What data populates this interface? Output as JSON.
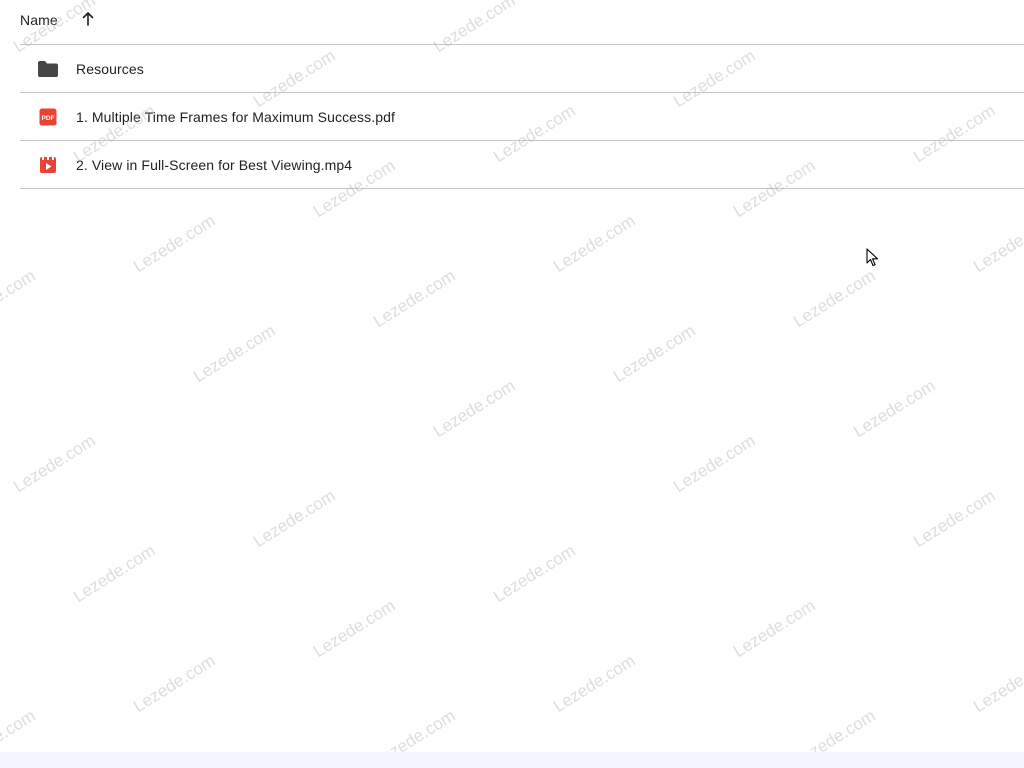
{
  "header": {
    "name_label": "Name",
    "sort_direction": "ascending"
  },
  "files": [
    {
      "name": "Resources",
      "type": "folder",
      "icon": "folder-icon",
      "icon_color": "#444746"
    },
    {
      "name": "1. Multiple Time Frames for Maximum Success.pdf",
      "type": "pdf",
      "icon": "pdf-icon",
      "icon_color": "#ea4335",
      "icon_text": "PDF"
    },
    {
      "name": "2. View in Full-Screen for Best Viewing.mp4",
      "type": "video",
      "icon": "video-icon",
      "icon_color": "#ea4335"
    }
  ],
  "watermark": {
    "text": "Lezede.com",
    "color": "#a0a0a0"
  },
  "colors": {
    "divider": "#c7c7c7",
    "text": "#1f1f1f",
    "background": "#ffffff"
  }
}
